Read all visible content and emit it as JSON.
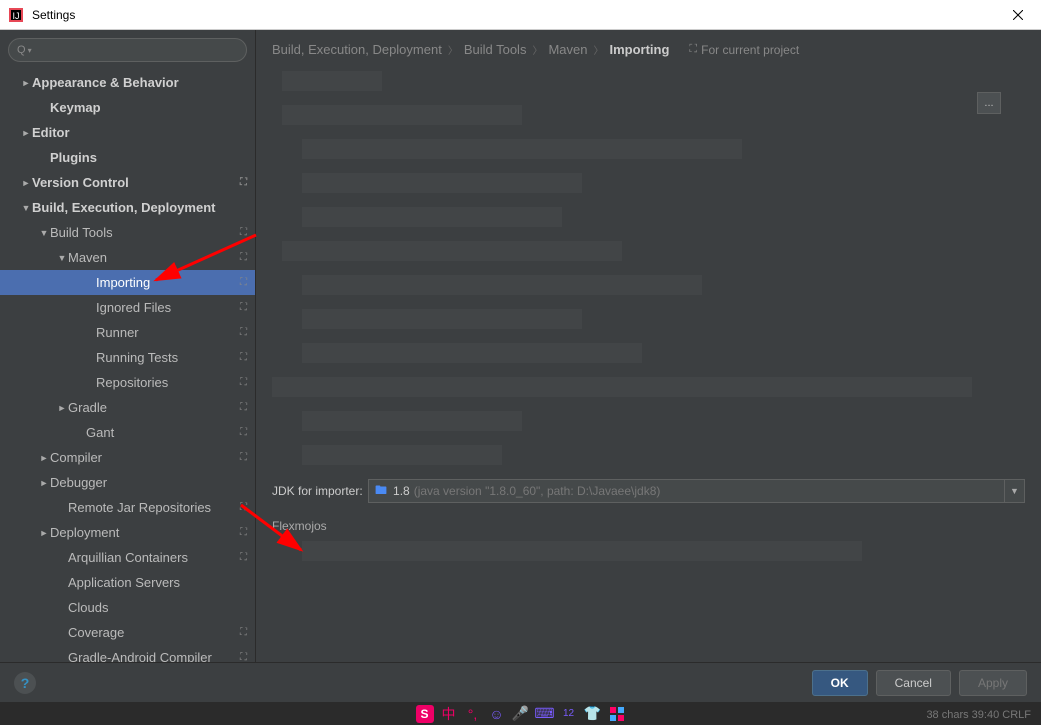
{
  "window": {
    "title": "Settings"
  },
  "sidebar": {
    "items": [
      {
        "label": "Appearance & Behavior",
        "level": 0,
        "arrow": "►",
        "bold": true
      },
      {
        "label": "Keymap",
        "level": 1,
        "arrow": "",
        "bold": true
      },
      {
        "label": "Editor",
        "level": 0,
        "arrow": "►",
        "bold": true
      },
      {
        "label": "Plugins",
        "level": 1,
        "arrow": "",
        "bold": true
      },
      {
        "label": "Version Control",
        "level": 0,
        "arrow": "►",
        "bold": true,
        "badge": "⛶"
      },
      {
        "label": "Build, Execution, Deployment",
        "level": 0,
        "arrow": "▼",
        "bold": true
      },
      {
        "label": "Build Tools",
        "level": 1,
        "arrow": "▼",
        "bold": false,
        "badge": "⛶"
      },
      {
        "label": "Maven",
        "level": 2,
        "arrow": "▼",
        "bold": false,
        "badge": "⛶"
      },
      {
        "label": "Importing",
        "level": 4,
        "arrow": "",
        "bold": false,
        "selected": true,
        "badge": "⛶"
      },
      {
        "label": "Ignored Files",
        "level": 4,
        "arrow": "",
        "bold": false,
        "badge": "⛶"
      },
      {
        "label": "Runner",
        "level": 4,
        "arrow": "",
        "bold": false,
        "badge": "⛶"
      },
      {
        "label": "Running Tests",
        "level": 4,
        "arrow": "",
        "bold": false,
        "badge": "⛶"
      },
      {
        "label": "Repositories",
        "level": 4,
        "arrow": "",
        "bold": false,
        "badge": "⛶"
      },
      {
        "label": "Gradle",
        "level": 2,
        "arrow": "►",
        "bold": false,
        "badge": "⛶"
      },
      {
        "label": "Gant",
        "level": 3,
        "arrow": "",
        "bold": false,
        "badge": "⛶"
      },
      {
        "label": "Compiler",
        "level": 1,
        "arrow": "►",
        "bold": false,
        "badge": "⛶"
      },
      {
        "label": "Debugger",
        "level": 1,
        "arrow": "►",
        "bold": false
      },
      {
        "label": "Remote Jar Repositories",
        "level": 2,
        "arrow": "",
        "bold": false,
        "badge": "⛶"
      },
      {
        "label": "Deployment",
        "level": 1,
        "arrow": "►",
        "bold": false,
        "badge": "⛶"
      },
      {
        "label": "Arquillian Containers",
        "level": 2,
        "arrow": "",
        "bold": false,
        "badge": "⛶"
      },
      {
        "label": "Application Servers",
        "level": 2,
        "arrow": "",
        "bold": false
      },
      {
        "label": "Clouds",
        "level": 2,
        "arrow": "",
        "bold": false
      },
      {
        "label": "Coverage",
        "level": 2,
        "arrow": "",
        "bold": false,
        "badge": "⛶"
      },
      {
        "label": "Gradle-Android Compiler",
        "level": 2,
        "arrow": "",
        "bold": false,
        "badge": "⛶"
      }
    ]
  },
  "breadcrumb": {
    "parts": [
      "Build, Execution, Deployment",
      "Build Tools",
      "Maven",
      "Importing"
    ],
    "for_project": "For current project"
  },
  "content": {
    "jdk_label": "JDK for importer:",
    "jdk_version": "1.8",
    "jdk_path": "(java version \"1.8.0_60\", path: D:\\Javaee\\jdk8)",
    "flexmojos": "Flexmojos",
    "browse": "..."
  },
  "footer": {
    "ok": "OK",
    "cancel": "Cancel",
    "apply": "Apply"
  },
  "taskbar": {
    "status": "38 chars    39:40   CRLF"
  }
}
